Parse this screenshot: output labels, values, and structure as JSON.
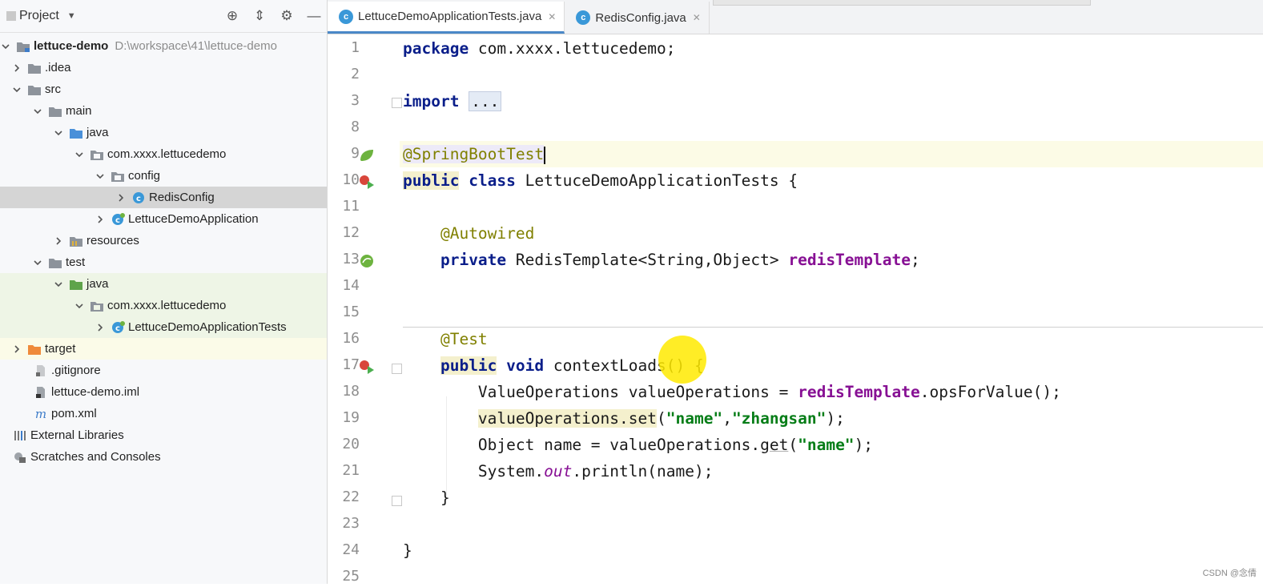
{
  "project_panel": {
    "title": "Project",
    "tree": [
      {
        "label": "lettuce-demo",
        "path": "D:\\workspace\\41\\lettuce-demo",
        "icon": "module-folder-icon",
        "expanded": true
      },
      {
        "label": ".idea",
        "icon": "folder-icon",
        "expanded": false
      },
      {
        "label": "src",
        "icon": "folder-icon",
        "expanded": true
      },
      {
        "label": "main",
        "icon": "folder-icon",
        "expanded": true
      },
      {
        "label": "java",
        "icon": "source-folder-icon",
        "expanded": true
      },
      {
        "label": "com.xxxx.lettucedemo",
        "icon": "package-icon",
        "expanded": true
      },
      {
        "label": "config",
        "icon": "package-icon",
        "expanded": true
      },
      {
        "label": "RedisConfig",
        "icon": "class-icon",
        "expanded": false,
        "selected": true
      },
      {
        "label": "LettuceDemoApplication",
        "icon": "spring-class-icon",
        "expanded": false
      },
      {
        "label": "resources",
        "icon": "resources-folder-icon",
        "expanded": false
      },
      {
        "label": "test",
        "icon": "folder-icon",
        "expanded": true
      },
      {
        "label": "java",
        "icon": "test-source-folder-icon",
        "expanded": true
      },
      {
        "label": "com.xxxx.lettucedemo",
        "icon": "package-icon",
        "expanded": true
      },
      {
        "label": "LettuceDemoApplicationTests",
        "icon": "spring-class-icon",
        "expanded": false
      },
      {
        "label": "target",
        "icon": "excluded-folder-icon",
        "expanded": false
      },
      {
        "label": ".gitignore",
        "icon": "file-icon"
      },
      {
        "label": "lettuce-demo.iml",
        "icon": "iml-file-icon"
      },
      {
        "label": "pom.xml",
        "icon": "maven-icon"
      },
      {
        "label": "External Libraries",
        "icon": "libraries-icon",
        "expanded": false
      },
      {
        "label": "Scratches and Consoles",
        "icon": "scratches-icon",
        "expanded": false
      }
    ]
  },
  "tabs": [
    {
      "label": "LettuceDemoApplicationTests.java",
      "icon": "class-icon",
      "active": true
    },
    {
      "label": "RedisConfig.java",
      "icon": "class-icon",
      "active": false
    }
  ],
  "editor": {
    "line_numbers": [
      "1",
      "2",
      "3",
      "8",
      "9",
      "10",
      "11",
      "12",
      "13",
      "14",
      "15",
      "16",
      "17",
      "18",
      "19",
      "20",
      "21",
      "22",
      "23",
      "24",
      "25"
    ],
    "code": {
      "l1_kw": "package",
      "l1_rest": " com.xxxx.lettucedemo;",
      "l3_kw": "import",
      "l3_fold": "...",
      "l9_ann": "@SpringBootTest",
      "l10_kw1": "public",
      "l10_kw2": "class",
      "l10_rest": " LettuceDemoApplicationTests {",
      "l12_ann": "@Autowired",
      "l13_kw": "private",
      "l13_type": " RedisTemplate<String,Object> ",
      "l13_field": "redisTemplate",
      "l13_end": ";",
      "l16_ann": "@Test",
      "l17_kw1": "public",
      "l17_kw2": "void",
      "l17_rest": " contextLoads() {",
      "l18_a": "ValueOperations valueOperations = ",
      "l18_field": "redisTemplate",
      "l18_b": ".opsForValue();",
      "l19_a": "valueOperations.set",
      "l19_b": "(",
      "l19_s1": "\"name\"",
      "l19_c": ",",
      "l19_s2": "\"zhangsan\"",
      "l19_d": ");",
      "l20_a": "Object name = valueOperations.",
      "l20_b": "get",
      "l20_c": "(",
      "l20_s": "\"name\"",
      "l20_d": ");",
      "l21_a": "System.",
      "l21_out": "out",
      "l21_b": ".println(name);",
      "l22": "}",
      "l24": "}"
    }
  },
  "watermark": "CSDN @念倩",
  "colors": {
    "accent": "#4a88c7",
    "keyword": "#0a1e8a",
    "annotation": "#808000",
    "string": "#067d17",
    "field": "#871094"
  }
}
